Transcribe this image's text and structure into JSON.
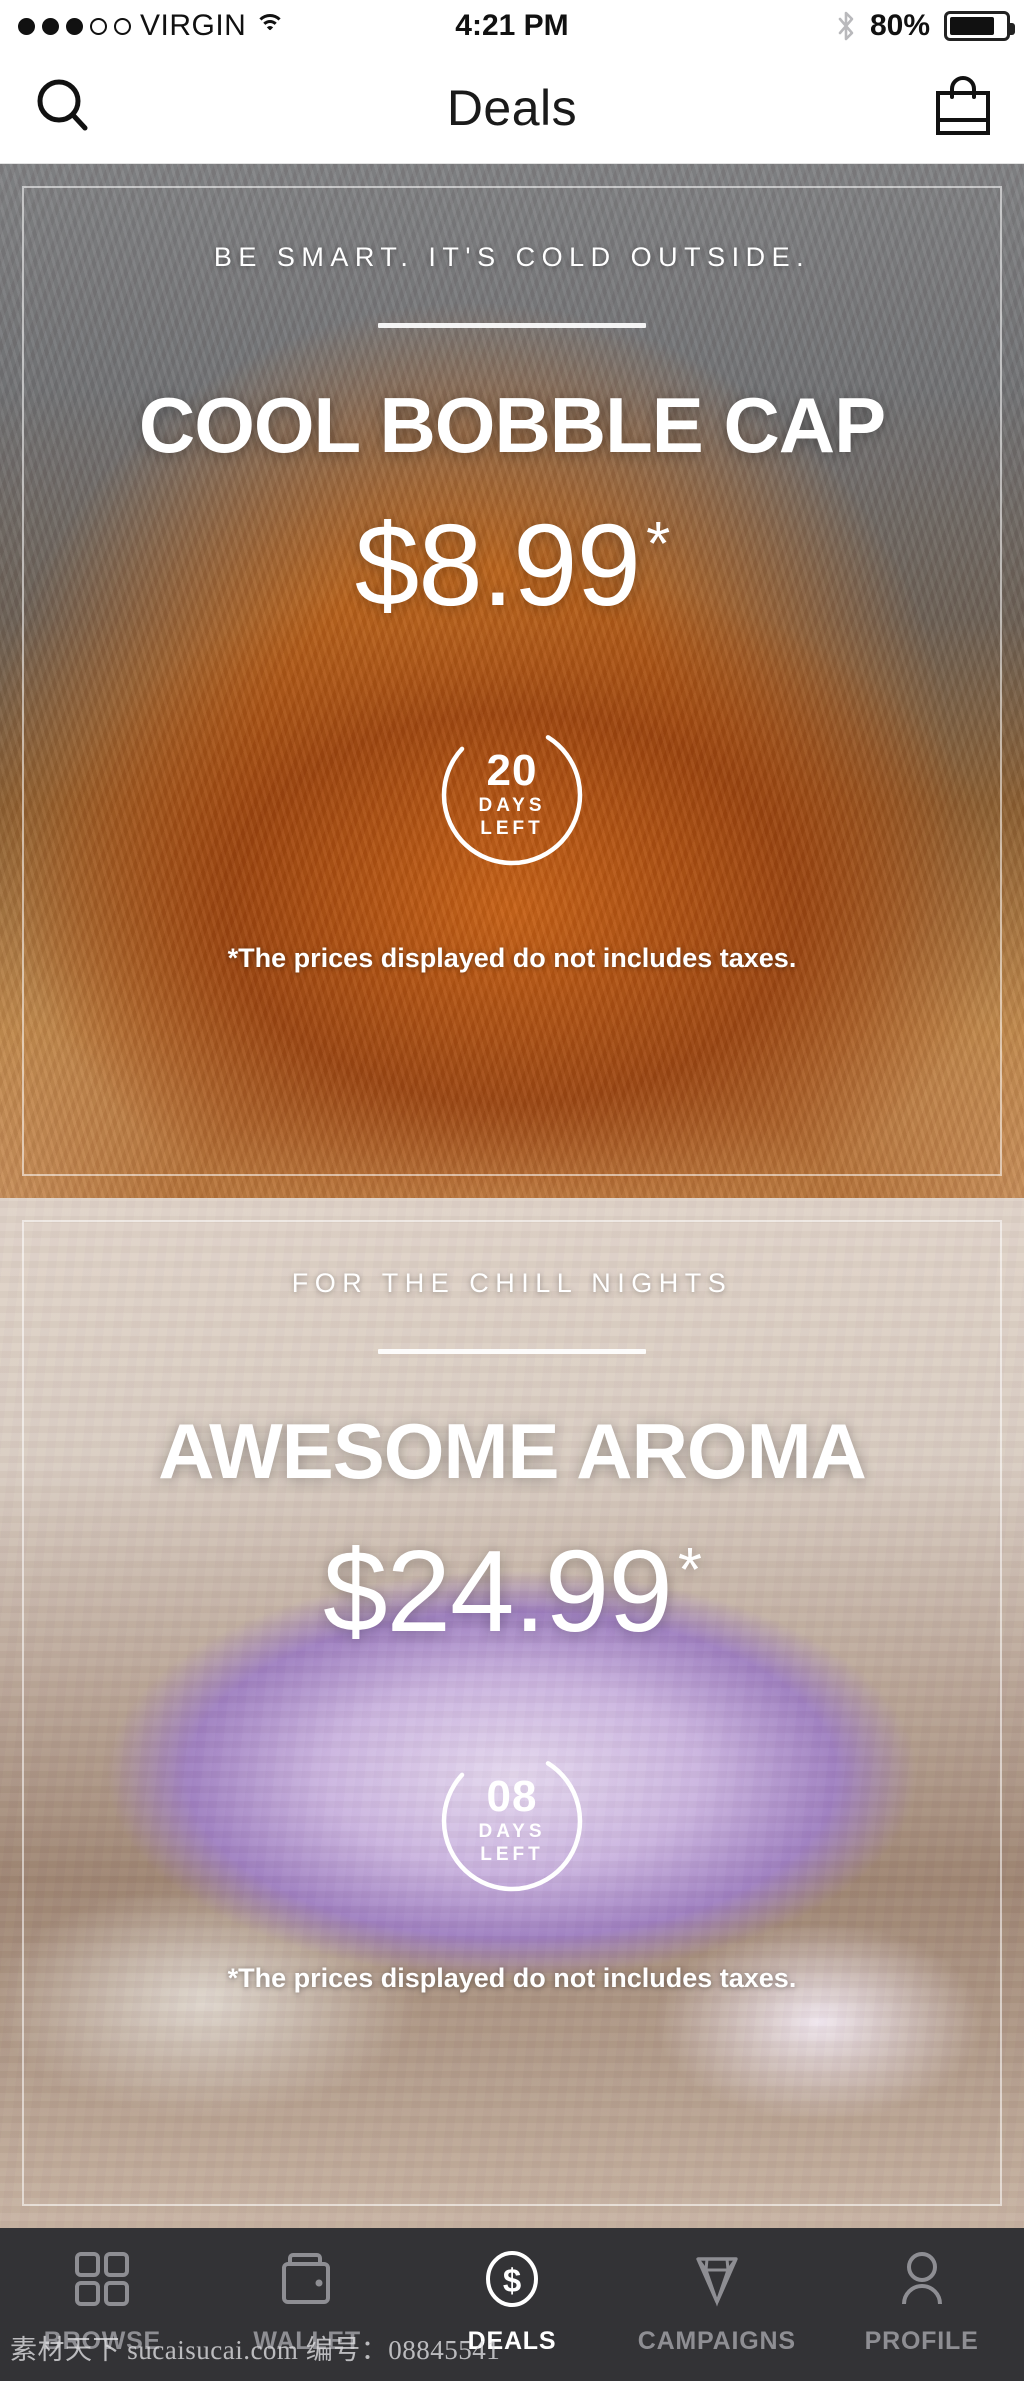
{
  "status_bar": {
    "carrier": "VIRGIN",
    "signal_dots_filled": 3,
    "signal_dots_total": 5,
    "wifi_icon": "wifi-icon",
    "time": "4:21 PM",
    "bluetooth_icon": "bluetooth-icon",
    "battery_percent": "80%",
    "battery_level": 80
  },
  "nav_bar": {
    "search_icon": "search-icon",
    "title": "Deals",
    "bag_icon": "shopping-bag-icon"
  },
  "deals": [
    {
      "kicker": "BE SMART. IT'S COLD OUTSIDE.",
      "title": "COOL BOBBLE CAP",
      "price": "$8.99",
      "price_asterisk": "*",
      "days_left": "20",
      "days_label_line1": "DAYS",
      "days_label_line2": "LEFT",
      "progress_percent": 78,
      "footnote": "*The prices displayed do not includes taxes."
    },
    {
      "kicker": "FOR THE CHILL NIGHTS",
      "title": "AWESOME AROMA",
      "price": "$24.99",
      "price_asterisk": "*",
      "days_left": "08",
      "days_label_line1": "DAYS",
      "days_label_line2": "LEFT",
      "progress_percent": 78,
      "footnote": "*The prices displayed do not includes taxes."
    }
  ],
  "tab_bar": {
    "active": "DEALS",
    "items": [
      {
        "label": "BROWSE",
        "icon": "grid-icon"
      },
      {
        "label": "WALLET",
        "icon": "wallet-icon"
      },
      {
        "label": "DEALS",
        "icon": "dollar-circle-icon"
      },
      {
        "label": "CAMPAIGNS",
        "icon": "diamond-icon"
      },
      {
        "label": "PROFILE",
        "icon": "person-icon"
      }
    ]
  },
  "watermark": "素材天下 sucaisucai.com  编号：08845541",
  "colors": {
    "tabbar_bg": "#333336",
    "tab_inactive": "#8e8e93",
    "tab_active": "#ffffff",
    "nav_text": "#1a1a1a",
    "card_text": "#ffffff"
  }
}
